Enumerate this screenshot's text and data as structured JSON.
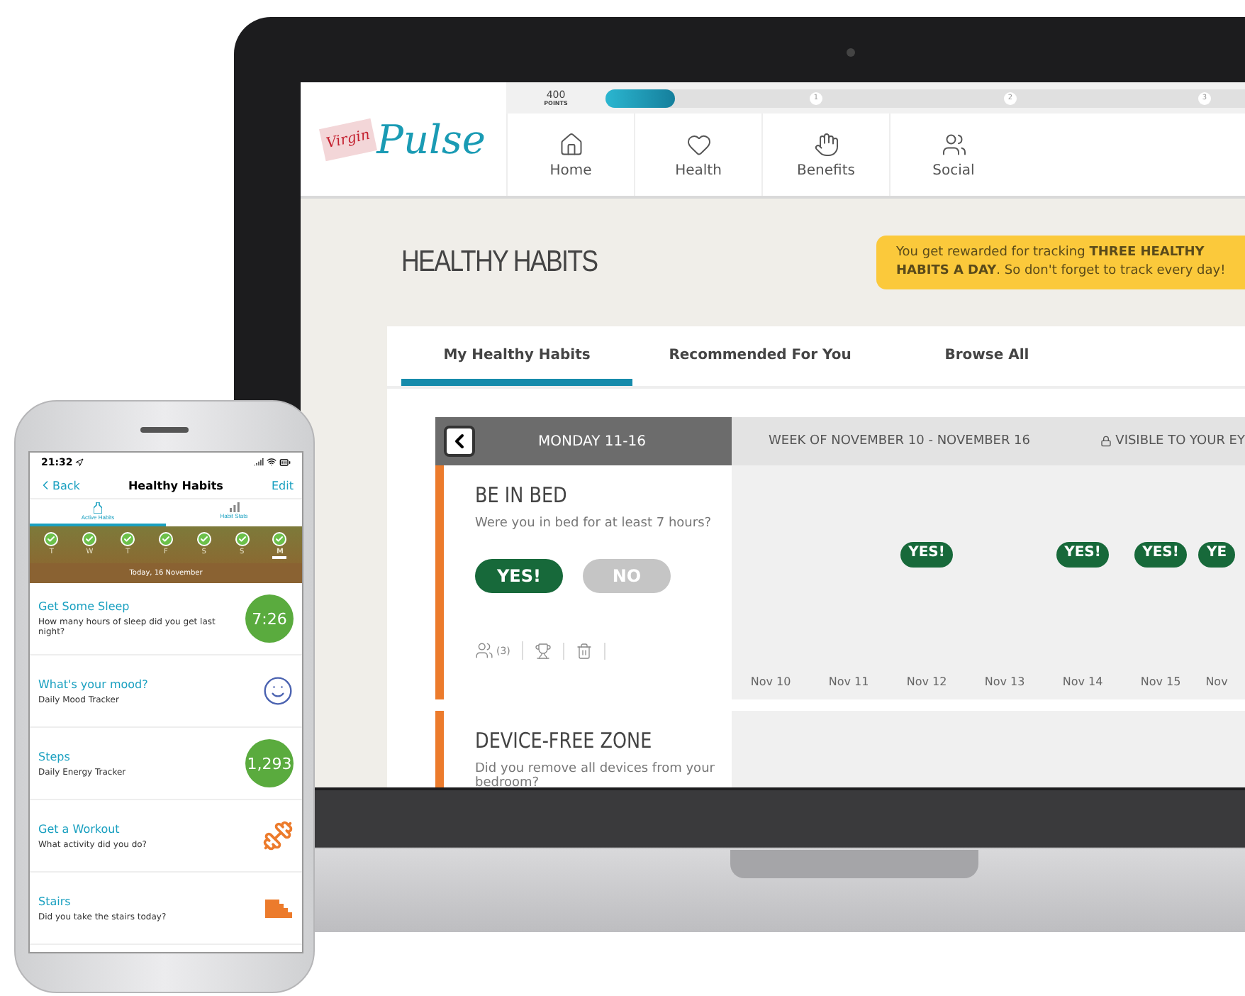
{
  "laptop": {
    "logo": {
      "top": "Virgin",
      "main": "Pulse"
    },
    "points": {
      "value": "400",
      "label": "POINTS",
      "level": 0.1,
      "milestones": [
        "1",
        "2",
        "3"
      ]
    },
    "nav": [
      {
        "label": "Home"
      },
      {
        "label": "Health"
      },
      {
        "label": "Benefits"
      },
      {
        "label": "Social"
      }
    ],
    "page_title": "HEALTHY HABITS",
    "banner": "You get rewarded for tracking **THREE HEALTHY HABITS A DAY**. So don't forget to track every day!",
    "tabs": [
      {
        "label": "My Healthy Habits",
        "selected": true
      },
      {
        "label": "Recommended For You",
        "selected": false
      },
      {
        "label": "Browse All",
        "selected": false
      }
    ],
    "tracker": {
      "day_label": "MONDAY 11-16",
      "week_label": "WEEK OF NOVEMBER 10 - NOVEMBER 16",
      "privacy": "VISIBLE TO YOUR EY",
      "habits": [
        {
          "title": "BE IN BED",
          "question": "Were you in bed for at least 7 hours?",
          "yes": "YES!",
          "no": "NO",
          "answered_yes": true,
          "buddies": "(3)",
          "days": [
            {
              "label": "Nov 10"
            },
            {
              "label": "Nov 11"
            },
            {
              "label": "Nov 12",
              "answer": "YES!"
            },
            {
              "label": "Nov 13"
            },
            {
              "label": "Nov 14",
              "answer": "YES!"
            },
            {
              "label": "Nov 15",
              "answer": "YES!"
            },
            {
              "label": "Nov",
              "answer": "YE"
            }
          ]
        },
        {
          "title": "DEVICE-FREE ZONE",
          "question": "Did you remove all devices from your bedroom?"
        }
      ]
    }
  },
  "phone": {
    "time": "21:32",
    "back": "Back",
    "title": "Healthy Habits",
    "edit": "Edit",
    "tabs": [
      {
        "label": "Active Habits",
        "selected": true
      },
      {
        "label": "Habit Stats",
        "selected": false
      }
    ],
    "days": [
      {
        "letter": "T",
        "checked": true,
        "selected": false
      },
      {
        "letter": "W",
        "checked": true,
        "selected": false
      },
      {
        "letter": "T",
        "checked": true,
        "selected": false
      },
      {
        "letter": "F",
        "checked": true,
        "selected": false
      },
      {
        "letter": "S",
        "checked": true,
        "selected": false
      },
      {
        "letter": "S",
        "checked": true,
        "selected": false
      },
      {
        "letter": "M",
        "checked": true,
        "selected": true
      }
    ],
    "date": "Today, 16 November",
    "habits": [
      {
        "kind": "value",
        "title": "Get Some Sleep",
        "subtitle": "How many hours of sleep did you get last night?",
        "value": "7:26"
      },
      {
        "kind": "mood",
        "title": "What's your mood?",
        "subtitle": "Daily Mood Tracker"
      },
      {
        "kind": "value",
        "title": "Steps",
        "subtitle": "Daily Energy Tracker",
        "value": "1,293"
      },
      {
        "kind": "workout",
        "title": "Get a Workout",
        "subtitle": "What activity did you do?"
      },
      {
        "kind": "stairs",
        "title": "Stairs",
        "subtitle": "Did you take the stairs today?"
      }
    ]
  }
}
